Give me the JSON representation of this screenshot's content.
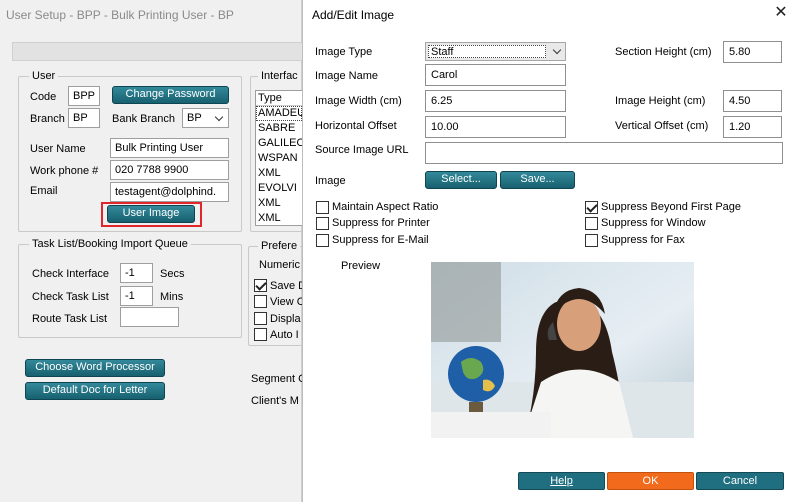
{
  "background_window": {
    "title": "User Setup - BPP - Bulk Printing User - BP",
    "user_group": {
      "title": "User",
      "code_label": "Code",
      "code_value": "BPP",
      "branch_label": "Branch",
      "branch_value": "BP",
      "change_password_label": "Change Password",
      "bank_branch_label": "Bank Branch",
      "bank_branch_value": "BP",
      "user_name_label": "User Name",
      "user_name_value": "Bulk Printing User",
      "work_phone_label": "Work phone #",
      "work_phone_value": "020 7788 9900",
      "email_label": "Email",
      "email_value": "testagent@dolphind.",
      "user_image_label": "User Image"
    },
    "interface_group": {
      "title": "Interfac",
      "column_header": "Type",
      "items": [
        "AMADEU",
        "SABRE",
        "GALILEO",
        "WSPAN",
        "XML",
        "EVOLVI",
        "XML",
        "XML"
      ]
    },
    "task_group": {
      "title": "Task List/Booking Import Queue",
      "check_interface_label": "Check Interface",
      "check_interface_value": "-1",
      "secs_label": "Secs",
      "check_task_label": "Check Task List",
      "check_task_value": "-1",
      "mins_label": "Mins",
      "route_task_label": "Route Task List",
      "route_task_value": ""
    },
    "preferences_group": {
      "title": "Prefere",
      "numeric_label": "Numeric",
      "items": [
        {
          "label": "Save D",
          "checked": true
        },
        {
          "label": "View C",
          "checked": false
        },
        {
          "label": "Displa",
          "checked": false
        },
        {
          "label": "Auto I",
          "checked": false
        }
      ]
    },
    "choose_word_processor_label": "Choose Word Processor",
    "default_doc_label": "Default Doc for Letter",
    "segment_label": "Segment C",
    "clients_label": "Client's M"
  },
  "dialog": {
    "title": "Add/Edit Image",
    "image_type_label": "Image Type",
    "image_type_value": "Staff",
    "image_name_label": "Image Name",
    "image_name_value": "Carol",
    "image_width_label": "Image Width (cm)",
    "image_width_value": "6.25",
    "horizontal_offset_label": "Horizontal Offset",
    "horizontal_offset_value": "10.00",
    "source_url_label": "Source Image URL",
    "source_url_value": "",
    "section_height_label": "Section Height (cm)",
    "section_height_value": "5.80",
    "image_height_label": "Image Height (cm)",
    "image_height_value": "4.50",
    "vertical_offset_label": "Vertical Offset (cm)",
    "vertical_offset_value": "1.20",
    "image_label": "Image",
    "select_button": "Select...",
    "save_button": "Save...",
    "checkboxes": {
      "maintain_aspect": {
        "label": "Maintain Aspect Ratio",
        "checked": false
      },
      "suppress_printer": {
        "label": "Suppress for Printer",
        "checked": false
      },
      "suppress_email": {
        "label": "Suppress for E-Mail",
        "checked": false
      },
      "suppress_beyond": {
        "label": "Suppress Beyond First Page",
        "checked": true
      },
      "suppress_window": {
        "label": "Suppress for Window",
        "checked": false
      },
      "suppress_fax": {
        "label": "Suppress for Fax",
        "checked": false
      }
    },
    "preview_label": "Preview",
    "help_button": "Help",
    "ok_button": "OK",
    "cancel_button": "Cancel"
  },
  "colors": {
    "teal_button": "#1f6f80",
    "ok_button": "#f26a1b",
    "highlight_box": "#e0262b"
  }
}
